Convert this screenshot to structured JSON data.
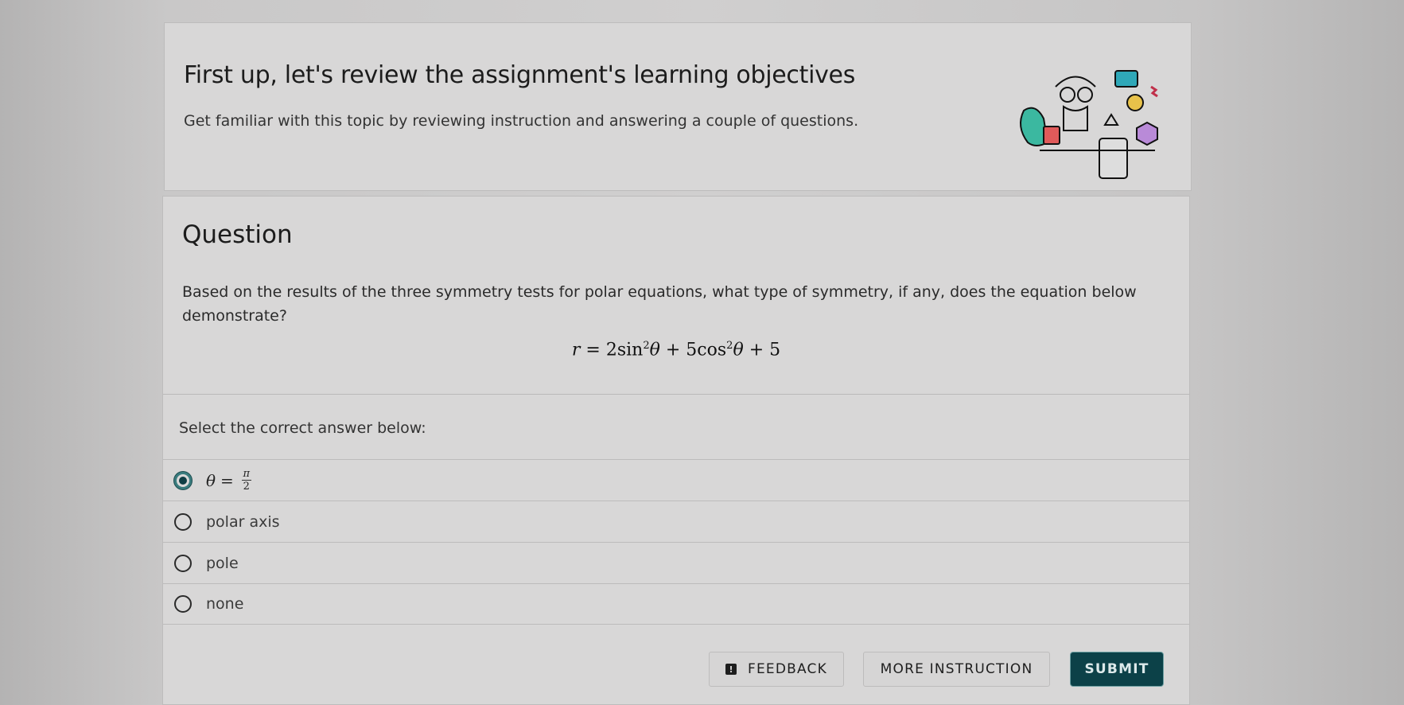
{
  "objectives": {
    "title": "First up, let's review the assignment's learning objectives",
    "subtitle": "Get familiar with this topic by reviewing instruction and answering a couple of questions."
  },
  "question": {
    "heading": "Question",
    "prompt": "Based on the results of the three symmetry tests for polar equations, what type of symmetry, if any, does the equation below demonstrate?",
    "equation": {
      "lhs": "r",
      "eq": "=",
      "term1_coef": "2",
      "term1_fn": "sin",
      "term1_exp": "2",
      "term1_var": "θ",
      "plus1": "+",
      "term2_coef": "5",
      "term2_fn": "cos",
      "term2_exp": "2",
      "term2_var": "θ",
      "plus2": "+",
      "const": "5"
    },
    "select_label": "Select the correct answer below:",
    "options": [
      {
        "var": "θ",
        "eq": "=",
        "num": "π",
        "den": "2",
        "selected": true
      },
      {
        "label": "polar axis",
        "selected": false
      },
      {
        "label": "pole",
        "selected": false
      },
      {
        "label": "none",
        "selected": false
      }
    ]
  },
  "buttons": {
    "feedback": "FEEDBACK",
    "feedback_icon": "!",
    "more_instruction": "MORE INSTRUCTION",
    "submit": "SUBMIT"
  },
  "colors": {
    "submit_bg": "#0c4148",
    "radio_selected": "#0f3e44"
  }
}
